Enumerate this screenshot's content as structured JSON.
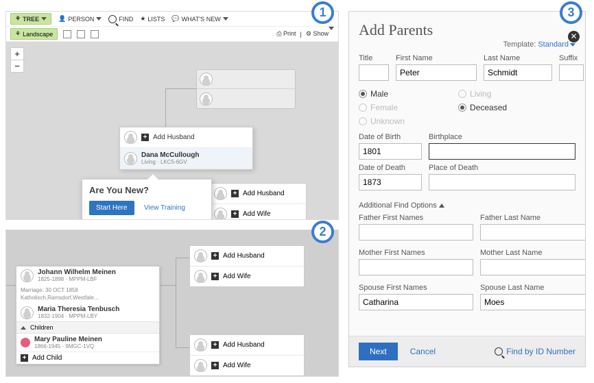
{
  "panel1": {
    "toolbar": {
      "tree": "TREE",
      "person": "PERSON",
      "find": "FIND",
      "lists": "LISTS",
      "whats_new": "WHAT'S NEW"
    },
    "subtoolbar": {
      "landscape": "Landscape",
      "print": "Print",
      "show": "Show"
    },
    "zoom": {
      "in": "+",
      "out": "−"
    },
    "focus": {
      "add_husband": "Add Husband",
      "name": "Dana McCullough",
      "meta": "Living · LKC5-6GV"
    },
    "right_slots": {
      "add_husband": "Add Husband",
      "add_wife": "Add Wife"
    },
    "popover": {
      "question": "Are You New?",
      "start_here": "Start Here",
      "view_training": "View Training"
    }
  },
  "panel2": {
    "family": {
      "father_name": "Johann Wilhelm Meinen",
      "father_meta": "1825-1898 · MPPM-LBF",
      "marriage_label": "Marriage:",
      "marriage_date": "30 OCT 1858",
      "marriage_place": "Katholisch,Ramsdorf,Westfale...",
      "mother_name": "Maria Theresia Tenbusch",
      "mother_meta": "1832-1904 · MPPM-LBY",
      "children_label": "Children",
      "child_name": "Mary Pauline Meinen",
      "child_meta": "1866-1945 · 9MGC-1VQ",
      "add_child": "Add Child"
    },
    "slots": {
      "add_husband": "Add Husband",
      "add_wife": "Add Wife"
    }
  },
  "panel3": {
    "title": "Add Parents",
    "template_label": "Template:",
    "template_value": "Standard",
    "fields": {
      "title_label": "Title",
      "title": "",
      "first_label": "First Name",
      "first": "Peter",
      "last_label": "Last Name",
      "last": "Schmidt",
      "suffix_label": "Suffix",
      "suffix": ""
    },
    "sex": {
      "male": "Male",
      "female": "Female",
      "unknown": "Unknown",
      "living": "Living",
      "deceased": "Deceased"
    },
    "life": {
      "dob_label": "Date of Birth",
      "dob": "1801",
      "birthplace_label": "Birthplace",
      "birthplace": "",
      "dod_label": "Date of Death",
      "dod": "1873",
      "deathplace_label": "Place of Death",
      "deathplace": ""
    },
    "additional": "Additional Find Options",
    "extra": {
      "father_first_label": "Father First Names",
      "father_first": "",
      "father_last_label": "Father Last Name",
      "father_last": "",
      "mother_first_label": "Mother First Names",
      "mother_first": "",
      "mother_last_label": "Mother Last Name",
      "mother_last": "",
      "spouse_first_label": "Spouse First Names",
      "spouse_first": "Catharina",
      "spouse_last_label": "Spouse Last Name",
      "spouse_last": "Moes"
    },
    "footer": {
      "next": "Next",
      "cancel": "Cancel",
      "find_by_id": "Find by ID Number"
    }
  },
  "badges": {
    "s1": "1",
    "s2": "2",
    "s3": "3"
  }
}
